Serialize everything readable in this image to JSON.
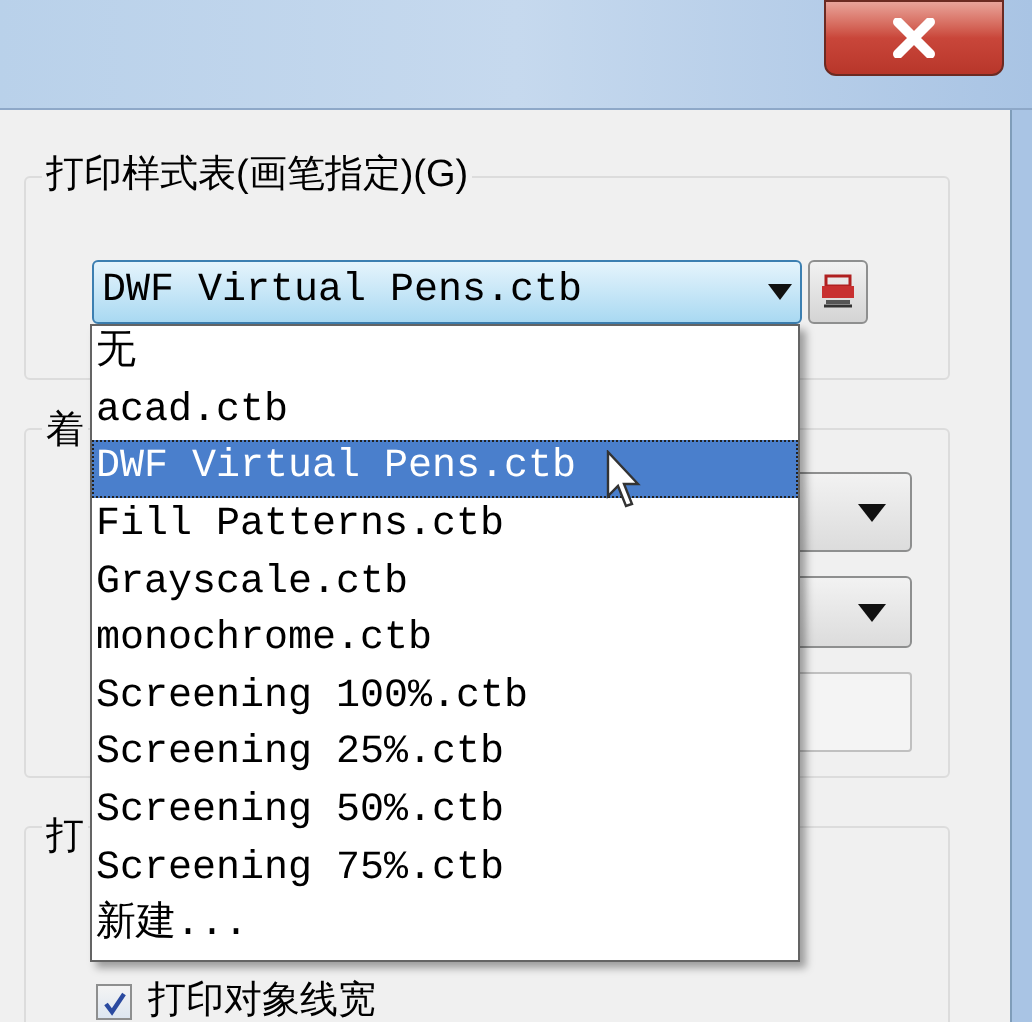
{
  "plot_style_table": {
    "label": "打印样式表(画笔指定)(G)",
    "combo": {
      "value": "DWF Virtual Pens.ctb",
      "expanded": true
    },
    "options": [
      {
        "label": "无",
        "selected": false
      },
      {
        "label": "acad.ctb",
        "selected": false
      },
      {
        "label": "DWF Virtual Pens.ctb",
        "selected": true
      },
      {
        "label": "Fill Patterns.ctb",
        "selected": false
      },
      {
        "label": "Grayscale.ctb",
        "selected": false
      },
      {
        "label": "monochrome.ctb",
        "selected": false
      },
      {
        "label": "Screening 100%.ctb",
        "selected": false
      },
      {
        "label": "Screening 25%.ctb",
        "selected": false
      },
      {
        "label": "Screening 50%.ctb",
        "selected": false
      },
      {
        "label": "Screening 75%.ctb",
        "selected": false
      },
      {
        "label": "新建...",
        "selected": false
      }
    ]
  },
  "group_2": {
    "label": "着"
  },
  "group_3": {
    "label": "打",
    "checkbox": {
      "label": "打印对象线宽",
      "checked": true
    }
  }
}
